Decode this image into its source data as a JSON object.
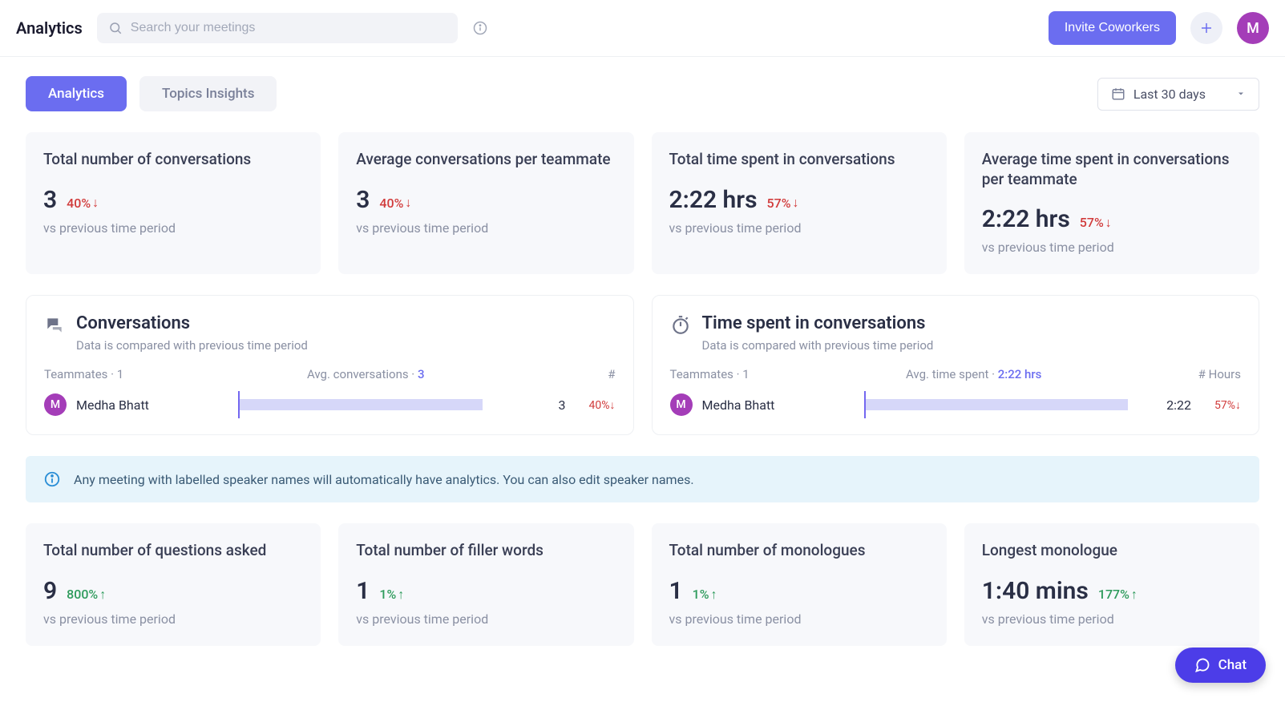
{
  "header": {
    "title": "Analytics",
    "search_placeholder": "Search your meetings",
    "invite_label": "Invite Coworkers",
    "avatar_initial": "M"
  },
  "tabs": {
    "analytics": "Analytics",
    "topics": "Topics Insights"
  },
  "date_range": {
    "label": "Last 30 days"
  },
  "kpi_top": [
    {
      "title": "Total number of conversations",
      "value": "3",
      "delta": "40%",
      "direction": "down",
      "sub": "vs previous time period"
    },
    {
      "title": "Average conversations per teammate",
      "value": "3",
      "delta": "40%",
      "direction": "down",
      "sub": "vs previous time period"
    },
    {
      "title": "Total time spent in conversations",
      "value": "2:22 hrs",
      "delta": "57%",
      "direction": "down",
      "sub": "vs previous time period"
    },
    {
      "title": "Average time spent in conversations per teammate",
      "value": "2:22 hrs",
      "delta": "57%",
      "direction": "down",
      "sub": "vs previous time period"
    }
  ],
  "panel_conversations": {
    "title": "Conversations",
    "subtitle": "Data is compared with previous time period",
    "left_label": "Teammates · 1",
    "mid_label_prefix": "Avg. conversations · ",
    "mid_value": "3",
    "right_label": "#",
    "row": {
      "initial": "M",
      "name": "Medha Bhatt",
      "value": "3",
      "delta": "40%",
      "direction": "down"
    }
  },
  "panel_time": {
    "title": "Time spent in conversations",
    "subtitle": "Data is compared with previous time period",
    "left_label": "Teammates · 1",
    "mid_label_prefix": "Avg. time spent · ",
    "mid_value": "2:22 hrs",
    "right_label": "# Hours",
    "row": {
      "initial": "M",
      "name": "Medha Bhatt",
      "value": "2:22",
      "delta": "57%",
      "direction": "down"
    }
  },
  "info_banner": {
    "text": "Any meeting with labelled speaker names will automatically have analytics. You can also edit speaker names."
  },
  "kpi_bottom": [
    {
      "title": "Total number of questions asked",
      "value": "9",
      "delta": "800%",
      "direction": "up",
      "sub": "vs previous time period"
    },
    {
      "title": "Total number of filler words",
      "value": "1",
      "delta": "1%",
      "direction": "up",
      "sub": "vs previous time period"
    },
    {
      "title": "Total number of monologues",
      "value": "1",
      "delta": "1%",
      "direction": "up",
      "sub": "vs previous time period"
    },
    {
      "title": "Longest monologue",
      "value": "1:40 mins",
      "delta": "177%",
      "direction": "up",
      "sub": "vs previous time period"
    }
  ],
  "chat": {
    "label": "Chat"
  }
}
